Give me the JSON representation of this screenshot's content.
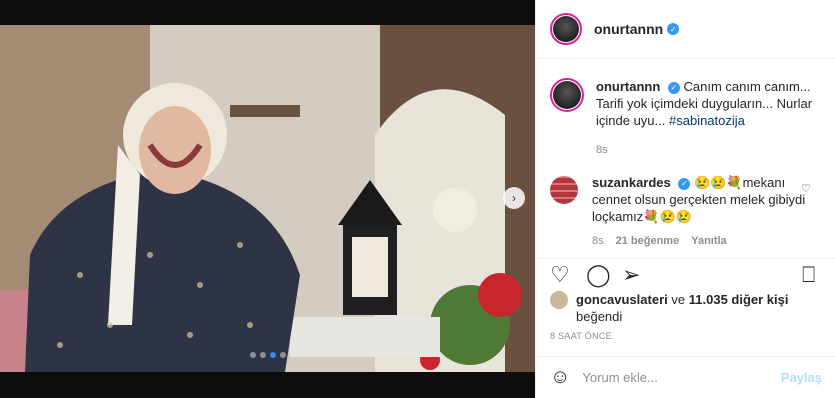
{
  "header": {
    "username": "onurtannn",
    "verified_icon": "verified-badge-icon"
  },
  "caption": {
    "username": "onurtannn",
    "text": "Canım canım canım... Tarifi yok içimdeki duyguların... Nurlar içinde uyu...",
    "hashtag": "#sabinatozija",
    "time": "8s"
  },
  "comment": {
    "username": "suzankardes",
    "text": "😢😢💐mekanı cennet olsun gerçekten melek gibiydi loçkamız💐😢😢",
    "time": "8s",
    "likes": "21 beğenme",
    "reply": "Yanıtla"
  },
  "actions": {
    "like_icon": "heart-icon",
    "comment_icon": "comment-icon",
    "share_icon": "share-icon",
    "save_icon": "bookmark-icon"
  },
  "likes": {
    "user": "goncavuslateri",
    "connector": "ve",
    "others": "11.035 diğer kişi",
    "suffix": "beğendi"
  },
  "posted_time": "8 SAAT ÖNCE",
  "add_comment": {
    "placeholder": "Yorum ekle...",
    "post_label": "Paylaş"
  },
  "carousel": {
    "total": 4,
    "active": 2
  },
  "colors": {
    "verified": "#3897f0",
    "hashtag": "#00376b",
    "post_disabled": "#b2dffc",
    "active_dot": "#2f8fe8"
  }
}
